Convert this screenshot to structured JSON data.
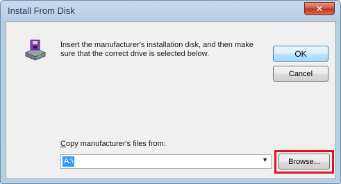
{
  "window": {
    "title": "Install From Disk",
    "close_icon": "close-icon"
  },
  "dialog": {
    "icon": "disk-drive-icon",
    "instructions": "Insert the manufacturer's installation disk, and then make sure that the correct drive is selected below.",
    "ok_label": "OK",
    "cancel_label": "Cancel",
    "copy_label": "Copy manufacturer's files from:",
    "copy_value": "A:\\",
    "browse_label": "Browse...",
    "highlight_color": "#e0141c"
  }
}
